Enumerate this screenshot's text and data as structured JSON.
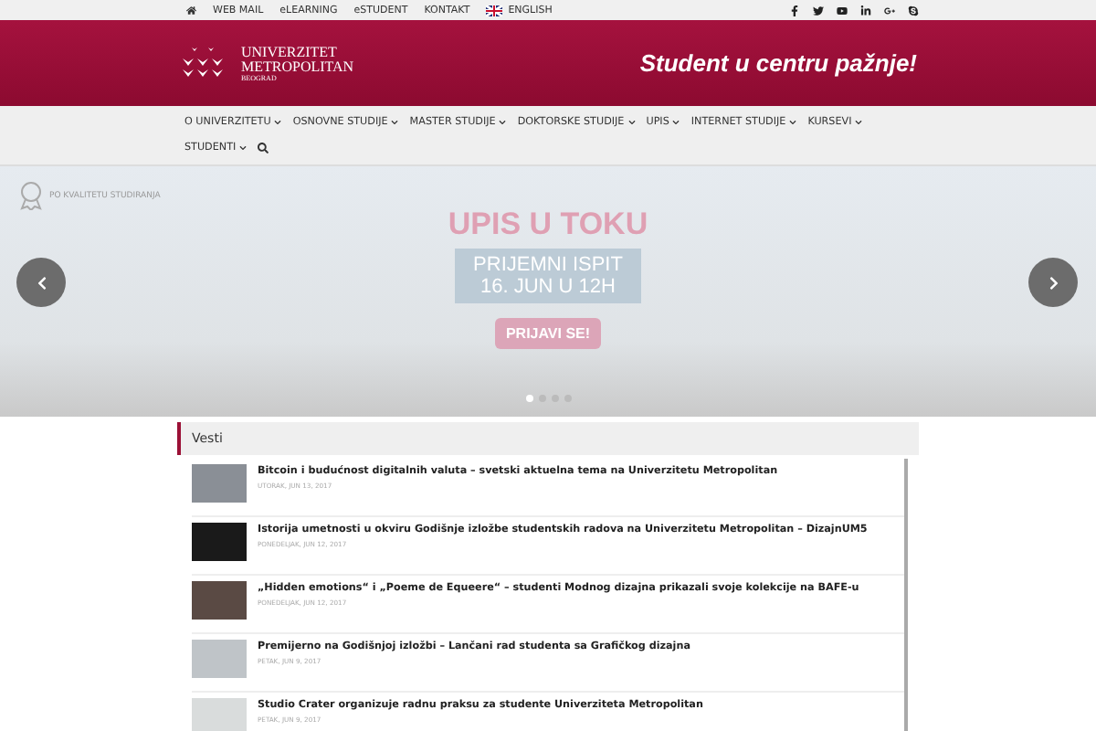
{
  "top_bar": {
    "links": [
      {
        "kind": "home"
      },
      {
        "kind": "text",
        "label": "WEB MAIL"
      },
      {
        "kind": "text",
        "label": "eLEARNING"
      },
      {
        "kind": "text",
        "label": "eSTUDENT"
      },
      {
        "kind": "text",
        "label": "KONTAKT"
      },
      {
        "kind": "flag",
        "label": "ENGLISH"
      }
    ],
    "social": [
      {
        "kind": "facebook"
      },
      {
        "kind": "twitter"
      },
      {
        "kind": "youtube"
      },
      {
        "kind": "linkedin"
      },
      {
        "kind": "google"
      },
      {
        "kind": "skype"
      }
    ]
  },
  "header": {
    "logo_lines": [
      "UNIVERZITET",
      "METROPOLITAN",
      "BEOGRAD"
    ],
    "slogan": "Student u centru pažnje!"
  },
  "nav": {
    "items": [
      {
        "label": "O UNIVERZITETU"
      },
      {
        "label": "OSNOVNE STUDIJE"
      },
      {
        "label": "MASTER STUDIJE"
      },
      {
        "label": "DOKTORSKE STUDIJE"
      },
      {
        "label": "UPIS"
      },
      {
        "label": "INTERNET STUDIJE"
      },
      {
        "label": "KURSEVI"
      },
      {
        "label": "STUDENTI"
      }
    ]
  },
  "hero": {
    "badge": "PO KVALITETU STUDIRANJA",
    "title": "UPIS U TOKU",
    "box_lines": [
      "PRIJEMNI ISPIT",
      "16. JUN U 12H"
    ],
    "button": "PRIJAVI SE!",
    "dots": [
      {
        "selected": true
      },
      {
        "selected": false
      },
      {
        "selected": false
      },
      {
        "selected": false
      }
    ]
  },
  "news": {
    "title": "Vesti",
    "items": [
      {
        "title": "Bitcoin i budućnost digitalnih valuta – svetski aktuelna tema na Univerzitetu Metropolitan",
        "date": "UTORAK, JUN 13, 2017"
      },
      {
        "title": "Istorija umetnosti u okviru Godišnje izložbe studentskih radova na Univerzitetu Metropolitan – DizajnUM5",
        "date": "PONEDELJAK, JUN 12, 2017"
      },
      {
        "title": "„Hidden emotions“ i „Poeme de Equeere“ – studenti Modnog dizajna prikazali svoje kolekcije na BAFE-u",
        "date": "PONEDELJAK, JUN 12, 2017"
      },
      {
        "title": "Premijerno na Godišnjoj izložbi – Lančani rad studenta sa Grafičkog dizajna",
        "date": "PETAK, JUN 9, 2017"
      },
      {
        "title": "Studio Crater organizuje radnu praksu za studente Univerziteta Metropolitan",
        "date": "PETAK, JUN 9, 2017"
      }
    ]
  }
}
